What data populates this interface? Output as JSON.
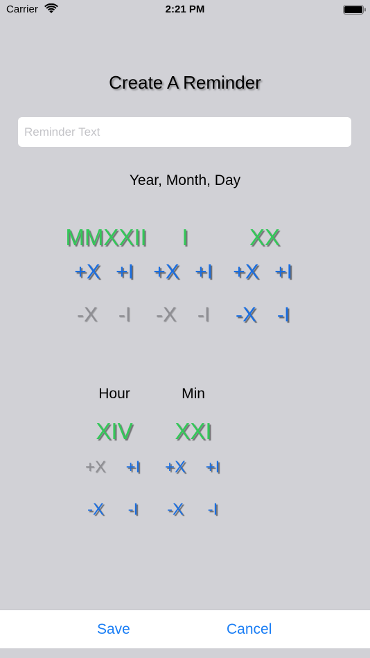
{
  "status": {
    "carrier": "Carrier",
    "time": "2:21 PM"
  },
  "title": "Create A Reminder",
  "reminder": {
    "placeholder": "Reminder Text",
    "value": ""
  },
  "date_label": "Year, Month, Day",
  "date": {
    "year": "MMXXII",
    "month": "I",
    "day": "XX",
    "plus_ten": "+X",
    "plus_one": "+I",
    "minus_ten": "-X",
    "minus_one": "-I"
  },
  "time": {
    "hour_label": "Hour",
    "min_label": "Min",
    "hour": "XIV",
    "min": "XXI",
    "plus_ten": "+X",
    "plus_one": "+I",
    "minus_ten": "-X",
    "minus_one": "-I"
  },
  "actions": {
    "save": "Save",
    "cancel": "Cancel"
  },
  "colors": {
    "accent": "#1a6ee0",
    "roman": "#34c759",
    "disabled": "#8e8e93",
    "background": "#d1d1d6"
  }
}
